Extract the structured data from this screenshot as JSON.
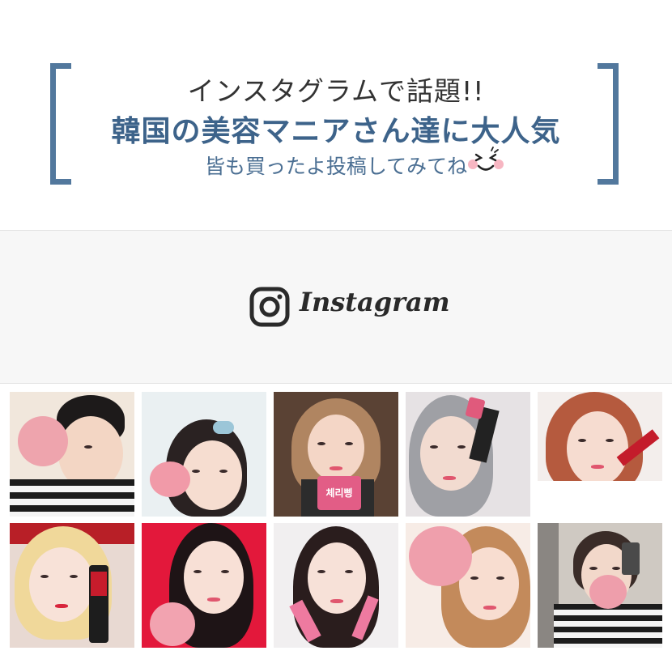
{
  "header": {
    "line1": "インスタグラムで話題!!",
    "line2": "韓国の美容マニアさん達に大人気",
    "line3": "皆も買ったよ投稿してみてね",
    "bracket_color": "#52789d",
    "emoji": "smiley-face-icon"
  },
  "instagram": {
    "brand": "Instagram",
    "icon": "instagram-camera-icon"
  },
  "photos": {
    "product_labels": {
      "tile3": "체리삥"
    },
    "tiles": [
      {
        "id": "photo-1",
        "desc": "boy-holding-pink-compact"
      },
      {
        "id": "photo-2",
        "desc": "girl-with-hair-roller-and-compact"
      },
      {
        "id": "photo-3",
        "desc": "girl-with-pink-box"
      },
      {
        "id": "photo-4",
        "desc": "girl-with-tint-bottle"
      },
      {
        "id": "photo-5",
        "desc": "girl-lying-with-lip-product"
      },
      {
        "id": "photo-6",
        "desc": "blonde-girl-with-tube"
      },
      {
        "id": "photo-7",
        "desc": "girl-with-compact-red-wall"
      },
      {
        "id": "photo-8",
        "desc": "girl-with-pink-applicators"
      },
      {
        "id": "photo-9",
        "desc": "girl-holding-compact-top"
      },
      {
        "id": "photo-10",
        "desc": "mirror-selfie-with-compact"
      }
    ]
  }
}
